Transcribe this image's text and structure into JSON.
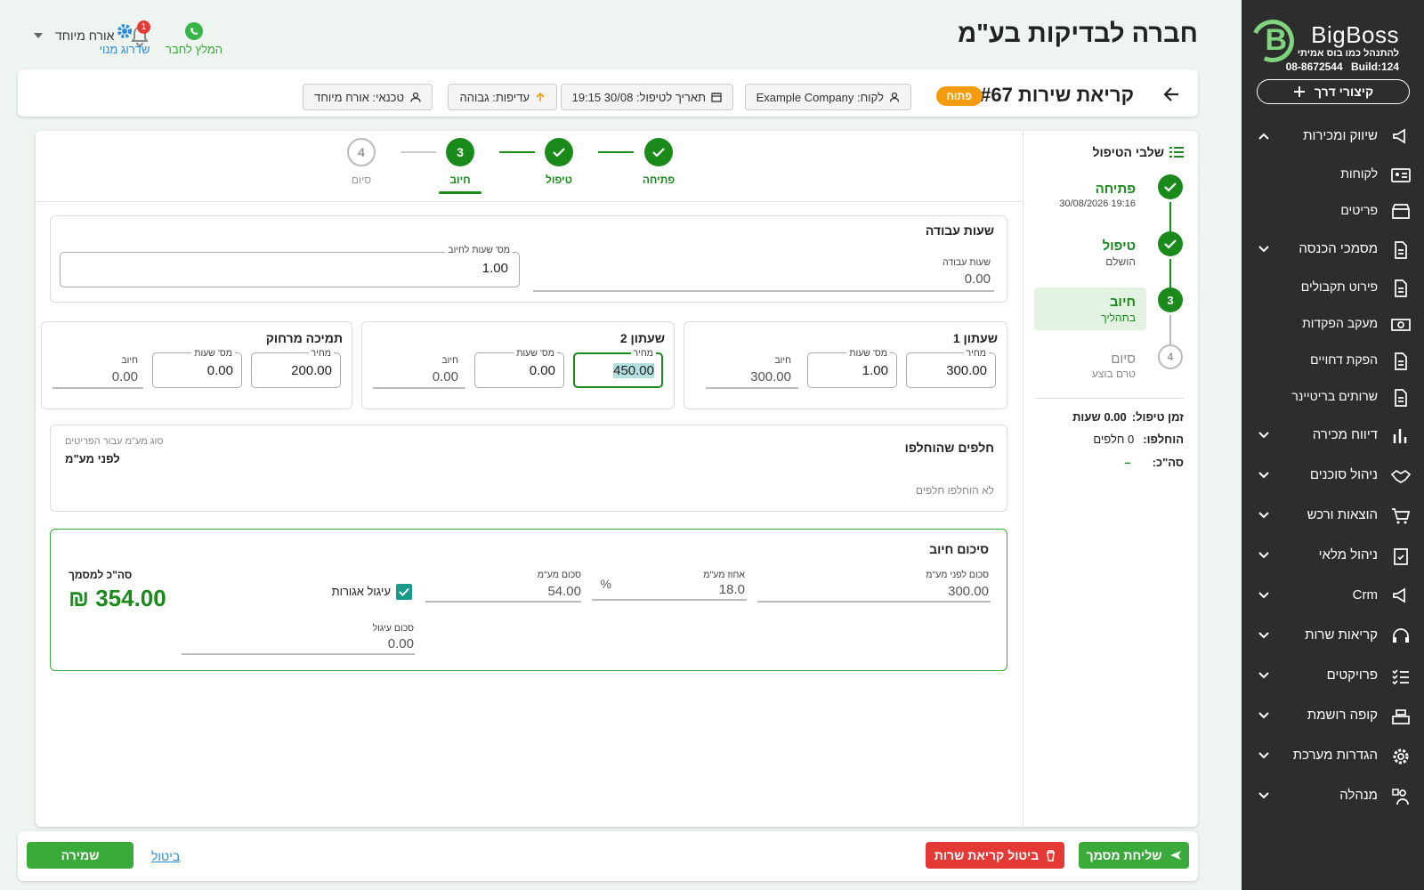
{
  "sidebar": {
    "logo_name": "BigBoss",
    "logo_tagline": "להתנהל כמו בוס אמיתי",
    "logo_phone": "08-8672544",
    "logo_build": "Build:124",
    "shortcuts_label": "קיצורי דרך",
    "items": [
      {
        "label": "שיווק ומכירות",
        "icon": "megaphone-icon"
      },
      {
        "label": "לקוחות",
        "icon": "contact-card-icon"
      },
      {
        "label": "פריטים",
        "icon": "store-icon"
      },
      {
        "label": "מסמכי הכנסה",
        "icon": "document-icon"
      },
      {
        "label": "פירוט תקבולים",
        "icon": "document-icon"
      },
      {
        "label": "מעקב הפקדות",
        "icon": "money-icon"
      },
      {
        "label": "הפקת דחויים",
        "icon": "document-icon"
      },
      {
        "label": "שרותים בריטיינר",
        "icon": "document-icon"
      },
      {
        "label": "דיווח מכירה",
        "icon": "bar-chart-icon"
      },
      {
        "label": "ניהול סוכנים",
        "icon": "handshake-icon"
      },
      {
        "label": "הוצאות ורכש",
        "icon": "cart-icon"
      },
      {
        "label": "ניהול מלאי",
        "icon": "clipboard-check-icon"
      },
      {
        "label": "Crm",
        "icon": "crm-icon"
      },
      {
        "label": "קריאות שרות",
        "icon": "headset-icon"
      },
      {
        "label": "פרויקטים",
        "icon": "checklist-icon"
      },
      {
        "label": "קופה רושמת",
        "icon": "cash-register-icon"
      },
      {
        "label": "הגדרות מערכת",
        "icon": "gear-icon"
      },
      {
        "label": "מנהלה",
        "icon": "admin-icon"
      }
    ]
  },
  "header": {
    "company": "חברה לבדיקות בע\"מ",
    "whatsapp_label": "המלץ לחבר",
    "upgrade_label": "שדרוג מנוי",
    "notif_count": "1",
    "user_label": "אורח מיוחד"
  },
  "call": {
    "title": "קריאת שירות #67",
    "status": "פתוח",
    "customer": "לקוח: Example Company",
    "date": "תאריך לטיפול: 30/08 19:15",
    "priority": "עדיפות: גבוהה",
    "technician": "טכנאי: אורח מיוחד"
  },
  "steps_panel": {
    "title": "שלבי הטיפול",
    "steps": [
      {
        "num": "",
        "name": "פתיחה",
        "sub": "30/08/2026 19:16"
      },
      {
        "num": "",
        "name": "טיפול",
        "sub": "הושלם"
      },
      {
        "num": "3",
        "name": "חיוב",
        "sub": "בתהליך"
      },
      {
        "num": "4",
        "name": "סיום",
        "sub": "טרם בוצע"
      }
    ],
    "time_label": "זמן טיפול:",
    "time_value": "0.00 שעות",
    "replaced_label": "הוחלפו:",
    "replaced_value": "0 חלפים",
    "total_label": "סה\"כ:",
    "total_value": "–"
  },
  "stepper": {
    "steps": [
      {
        "label": "פתיחה",
        "num": ""
      },
      {
        "label": "טיפול",
        "num": ""
      },
      {
        "label": "חיוב",
        "num": "3"
      },
      {
        "label": "סיום",
        "num": "4"
      }
    ]
  },
  "work_hours": {
    "title": "שעות עבודה",
    "hours_label": "שעות עבודה",
    "hours_value": "0.00",
    "bill_label": "מס' שעות לחיוב",
    "bill_value": "1.00"
  },
  "rates": [
    {
      "title": "שעתון 1",
      "price_label": "מחיר",
      "price": "300.00",
      "hours_label": "מס' שעות",
      "hours": "1.00",
      "charge_label": "חיוב",
      "charge": "300.00"
    },
    {
      "title": "שעתון 2",
      "price_label": "מחיר",
      "price": "450.00",
      "hours_label": "מס' שעות",
      "hours": "0.00",
      "charge_label": "חיוב",
      "charge": "0.00"
    },
    {
      "title": "תמיכה מרחוק",
      "price_label": "מחיר",
      "price": "200.00",
      "hours_label": "מס' שעות",
      "hours": "0.00",
      "charge_label": "חיוב",
      "charge": "0.00"
    }
  ],
  "parts": {
    "title": "חלפים שהוחלפו",
    "vat_type_label": "סוג מע\"מ עבור הפריטים",
    "vat_type_value": "לפני מע\"מ",
    "empty_text": "לא הוחלפו חלפים"
  },
  "summary": {
    "title": "סיכום חיוב",
    "before_vat_label": "סכום לפני מע\"מ",
    "before_vat": "300.00",
    "vat_pct_label": "אחוז מע\"מ",
    "vat_pct": "18.0",
    "pct_sign": "%",
    "vat_amount_label": "סכום מע\"מ",
    "vat_amount": "54.00",
    "rounding_label": "עיגול אגורות",
    "rounding_checked": true,
    "rounding_amount_label": "סכום עיגול",
    "rounding_amount": "0.00",
    "total_label": "סה\"כ למסמך",
    "total_value": "₪ 354.00"
  },
  "actions": {
    "send_label": "שליחת מסמך",
    "cancel_call_label": "ביטול קריאת שרות",
    "cancel_label": "ביטול",
    "save_label": "שמירה"
  },
  "colors": {
    "green": "#1a8a1a",
    "sidebar": "#2d2d2d",
    "orange": "#f59b0d",
    "red": "#e53935",
    "teal": "#1a9a8a"
  }
}
